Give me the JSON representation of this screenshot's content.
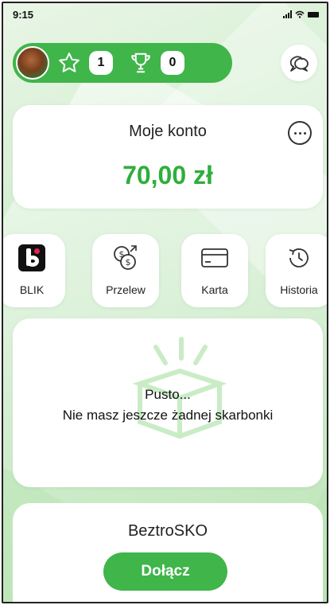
{
  "status_bar": {
    "time": "9:15"
  },
  "header": {
    "stars_count": "1",
    "trophies_count": "0",
    "icons": {
      "star": "star-icon",
      "trophy": "trophy-icon",
      "chat": "chat-bubbles-icon"
    }
  },
  "account": {
    "title": "Moje konto",
    "balance": "70,00 zł",
    "balance_color": "#2fae3c"
  },
  "actions": [
    {
      "label": "BLIK",
      "icon": "blik-logo-icon"
    },
    {
      "label": "Przelew",
      "icon": "money-transfer-icon"
    },
    {
      "label": "Karta",
      "icon": "card-icon"
    },
    {
      "label": "Historia",
      "icon": "history-icon"
    }
  ],
  "piggy_banks": {
    "empty_title": "Pusto...",
    "empty_message": "Nie masz jeszcze żadnej skarbonki"
  },
  "beztrosko": {
    "name": "BeztroSKO",
    "join_label": "Dołącz"
  },
  "colors": {
    "accent": "#3fb54a",
    "background": "#d2eed0"
  }
}
